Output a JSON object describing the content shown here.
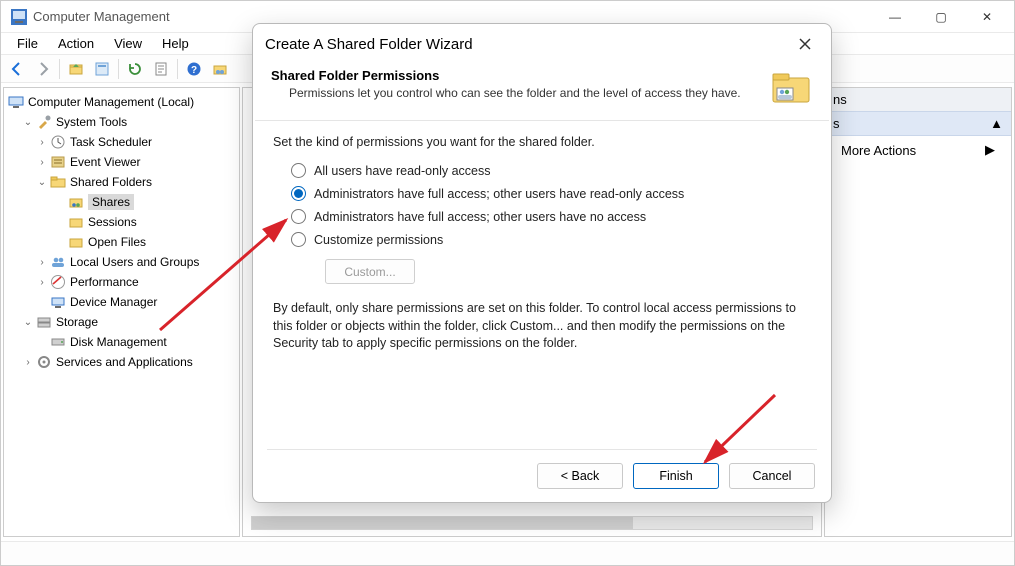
{
  "window": {
    "title": "Computer Management",
    "menus": [
      "File",
      "Action",
      "View",
      "Help"
    ],
    "win_controls": {
      "min": "—",
      "max": "▢",
      "close": "✕"
    }
  },
  "tree": {
    "root": "Computer Management (Local)",
    "items": [
      {
        "label": "System Tools",
        "lvl": 1,
        "exp": "open"
      },
      {
        "label": "Task Scheduler",
        "lvl": 2,
        "exp": "closed"
      },
      {
        "label": "Event Viewer",
        "lvl": 2,
        "exp": "closed"
      },
      {
        "label": "Shared Folders",
        "lvl": 2,
        "exp": "open"
      },
      {
        "label": "Shares",
        "lvl": 3,
        "sel": true
      },
      {
        "label": "Sessions",
        "lvl": 3
      },
      {
        "label": "Open Files",
        "lvl": 3
      },
      {
        "label": "Local Users and Groups",
        "lvl": 2,
        "exp": "closed"
      },
      {
        "label": "Performance",
        "lvl": 2,
        "exp": "closed"
      },
      {
        "label": "Device Manager",
        "lvl": 2
      },
      {
        "label": "Storage",
        "lvl": 1,
        "exp": "open"
      },
      {
        "label": "Disk Management",
        "lvl": 2
      },
      {
        "label": "Services and Applications",
        "lvl": 1,
        "exp": "closed"
      }
    ]
  },
  "actions": {
    "header": "ns",
    "section": "s",
    "item": "More Actions"
  },
  "wizard": {
    "title": "Create A Shared Folder Wizard",
    "heading": "Shared Folder Permissions",
    "subheading": "Permissions let you control who can see the folder and the level of access they have.",
    "lead": "Set the kind of permissions you want for the shared folder.",
    "options": [
      "All users have read-only access",
      "Administrators have full access; other users have read-only access",
      "Administrators have full access; other users have no access",
      "Customize permissions"
    ],
    "selected_index": 1,
    "custom_btn": "Custom...",
    "note": "By default, only share permissions are set on this folder. To control local access permissions to this folder or objects within the folder, click Custom... and then modify the permissions on the Security tab to apply specific permissions on the folder.",
    "buttons": {
      "back": "< Back",
      "finish": "Finish",
      "cancel": "Cancel"
    }
  }
}
